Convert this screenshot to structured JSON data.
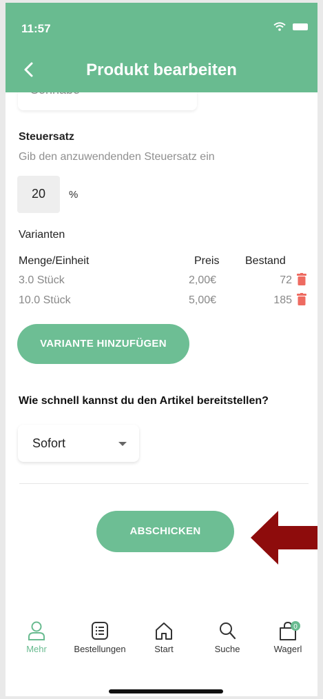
{
  "status": {
    "time": "11:57"
  },
  "header": {
    "title": "Produkt bearbeiten"
  },
  "cut_field": {
    "value": "Sonnabe"
  },
  "tax": {
    "label": "Steuersatz",
    "hint": "Gib den anzuwendenden Steuersatz ein",
    "value": "20",
    "unit": "%"
  },
  "variants": {
    "title": "Varianten",
    "columns": [
      "Menge/Einheit",
      "Preis",
      "Bestand"
    ],
    "rows": [
      {
        "qty": "3.0 Stück",
        "price": "2,00€",
        "stock": "72"
      },
      {
        "qty": "10.0 Stück",
        "price": "5,00€",
        "stock": "185"
      }
    ],
    "add_label": "VARIANTE HINZUFÜGEN"
  },
  "delivery": {
    "question": "Wie schnell kannst du den Artikel bereitstellen?",
    "selected": "Sofort"
  },
  "submit_label": "ABSCHICKEN",
  "tabbar": {
    "items": [
      {
        "label": "Mehr",
        "icon": "person-icon",
        "active": true
      },
      {
        "label": "Bestellungen",
        "icon": "list-icon"
      },
      {
        "label": "Start",
        "icon": "home-icon"
      },
      {
        "label": "Suche",
        "icon": "search-icon"
      },
      {
        "label": "Wagerl",
        "icon": "bag-icon",
        "badge": "0"
      }
    ]
  },
  "colors": {
    "accent": "#69bb90",
    "delete": "#ee6b61",
    "arrow": "#8e0c0c"
  }
}
